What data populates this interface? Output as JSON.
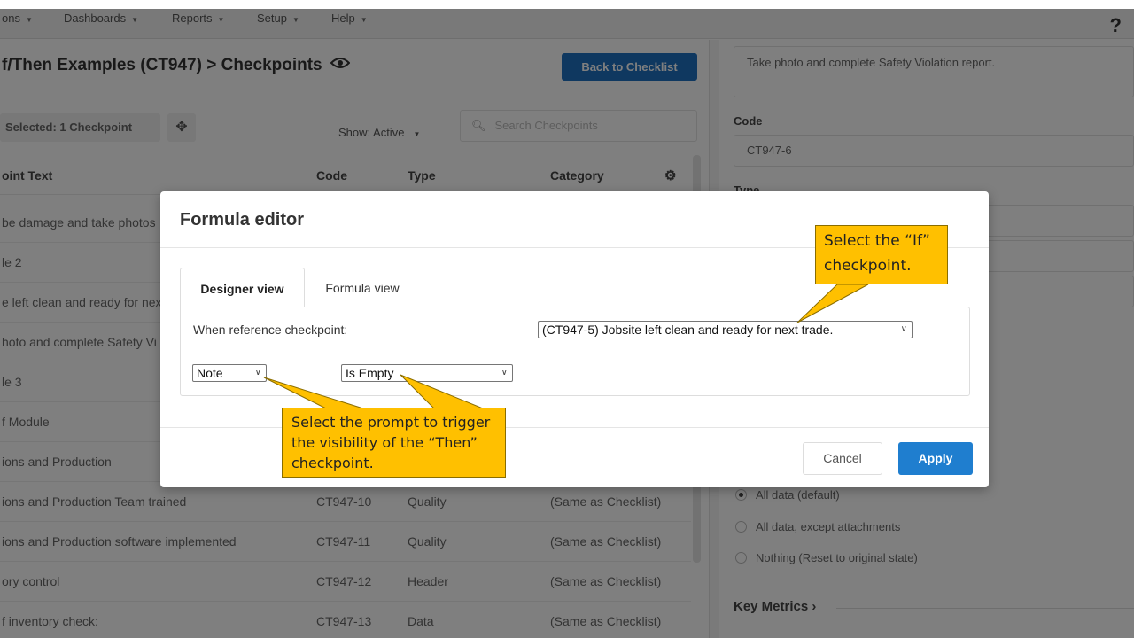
{
  "nav": {
    "items": [
      "ons",
      "Dashboards",
      "Reports",
      "Setup",
      "Help"
    ],
    "help_icon": "?"
  },
  "page": {
    "title": "f/Then Examples (CT947) > Checkpoints",
    "eye_icon": "eye-icon",
    "back_button": "Back to Checklist",
    "selected_label": "Selected: 1 Checkpoint",
    "show_label": "Show: Active",
    "search_placeholder": "Search Checkpoints"
  },
  "table": {
    "columns": [
      "oint Text",
      "Code",
      "Type",
      "Category"
    ],
    "rows": [
      {
        "text": "be damage and take photos",
        "code": "",
        "type": "",
        "category": ""
      },
      {
        "text": "le 2",
        "code": "",
        "type": "",
        "category": ""
      },
      {
        "text": "e left clean and ready for nex",
        "code": "",
        "type": "",
        "category": ""
      },
      {
        "text": "hoto and complete Safety Vi",
        "code": "",
        "type": "",
        "category": ""
      },
      {
        "text": "le 3",
        "code": "",
        "type": "",
        "category": ""
      },
      {
        "text": "f Module",
        "code": "",
        "type": "",
        "category": ""
      },
      {
        "text": "ions and Production",
        "code": "",
        "type": "",
        "category": ""
      },
      {
        "text": "ions and Production Team trained",
        "code": "CT947-10",
        "type": "Quality",
        "category": "(Same as Checklist)"
      },
      {
        "text": "ions and Production software implemented",
        "code": "CT947-11",
        "type": "Quality",
        "category": "(Same as Checklist)"
      },
      {
        "text": "ory control",
        "code": "CT947-12",
        "type": "Header",
        "category": "(Same as Checklist)"
      },
      {
        "text": "f inventory check:",
        "code": "CT947-13",
        "type": "Data",
        "category": "(Same as Checklist)"
      }
    ]
  },
  "right_panel": {
    "text_value": "Take photo and complete Safety Violation report.",
    "code_label": "Code",
    "code_value": "CT947-6",
    "type_label": "Type",
    "radio_options": [
      {
        "label": "All data (default)",
        "checked": true
      },
      {
        "label": "All data, except attachments",
        "checked": false
      },
      {
        "label": "Nothing (Reset to original state)",
        "checked": false
      }
    ],
    "key_metrics": "Key Metrics ›"
  },
  "modal": {
    "title": "Formula editor",
    "tabs": [
      "Designer view",
      "Formula view"
    ],
    "active_tab": "Designer view",
    "when_label": "When reference checkpoint:",
    "reference_select": "(CT947-5) Jobsite left clean and ready for next trade.",
    "prompt_select": "Note",
    "condition_select": "Is Empty",
    "cancel": "Cancel",
    "apply": "Apply"
  },
  "callouts": {
    "if_callout": "Select the “If” checkpoint.",
    "prompt_callout": "Select the prompt to trigger the visibility of the “Then” checkpoint."
  },
  "colors": {
    "accent": "#1f7ecf",
    "callout": "#ffc000"
  }
}
